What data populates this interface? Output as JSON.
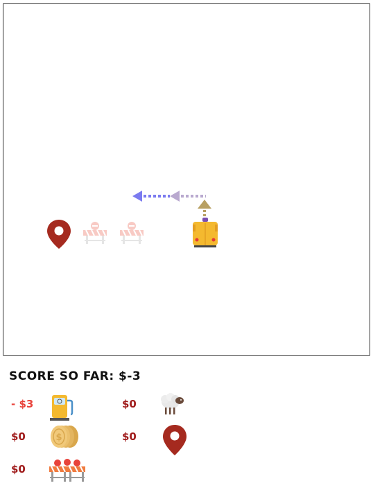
{
  "score": {
    "label": "SCORE SO FAR:",
    "value": "$-3"
  },
  "legend": {
    "fuel": {
      "amount": "- $3",
      "icon": "fuel-pump-icon"
    },
    "sheep": {
      "amount": "$0",
      "icon": "sheep-icon"
    },
    "coins": {
      "amount": "$0",
      "icon": "coin-stack-icon"
    },
    "destination": {
      "amount": "$0",
      "icon": "map-pin-icon"
    },
    "roadblock": {
      "amount": "$0",
      "icon": "roadblock-icon"
    }
  },
  "colors": {
    "pin": "#a52a1f",
    "van": "#f4b92f",
    "arrow_blue": "#7b7bf0",
    "arrow_lilac": "#b9a9cf",
    "arrow_tan": "#b8a062",
    "barrier_faded": "#f6c9c2",
    "negative": "#e8433b",
    "amount": "#a01c1c"
  }
}
